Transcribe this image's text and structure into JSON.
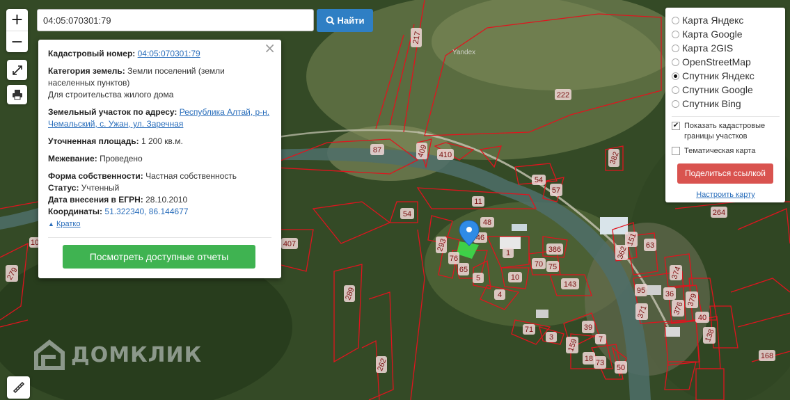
{
  "search": {
    "value": "04:05:070301:79",
    "button_label": "Найти"
  },
  "popup": {
    "cadastral_label": "Кадастровый номер:",
    "cadastral_value": "04:05:070301:79",
    "category_label": "Категория земель:",
    "category_value": "Земли поселений (земли населенных пунктов)",
    "purpose": "Для строительства жилого дома",
    "address_label": "Земельный участок по адресу:",
    "address_value": "Республика Алтай, р-н. Чемальский, с. Ужан, ул. Заречная",
    "area_label": "Уточненная площадь:",
    "area_value": "1 200 кв.м.",
    "survey_label": "Межевание:",
    "survey_value": "Проведено",
    "ownership_label": "Форма собственности:",
    "ownership_value": "Частная собственность",
    "status_label": "Статус:",
    "status_value": "Учтенный",
    "date_label": "Дата внесения в ЕГРН:",
    "date_value": "28.10.2010",
    "coords_label": "Координаты:",
    "coords_value": "51.322340, 86.144677",
    "collapse_label": "Кратко",
    "report_button": "Посмотреть доступные отчеты"
  },
  "layers": {
    "options": [
      "Карта Яндекс",
      "Карта Google",
      "Карта 2GIS",
      "OpenStreetMap",
      "Спутник Яндекс",
      "Спутник Google",
      "Спутник Bing"
    ],
    "selected": "Спутник Яндекс",
    "show_borders_label": "Показать кадастровые границы участков",
    "show_borders_checked": true,
    "thematic_label": "Тематическая карта",
    "thematic_checked": false,
    "share_button": "Поделиться ссылкой",
    "configure_link": "Настроить карту"
  },
  "watermarks": {
    "brand": "ДОМКЛИК",
    "yandex": "Yandex"
  },
  "parcel_labels": [
    "217",
    "222",
    "87",
    "409",
    "410",
    "382",
    "54",
    "57",
    "11",
    "54",
    "48",
    "46",
    "293",
    "1",
    "386",
    "76",
    "65",
    "70",
    "75",
    "5",
    "10",
    "143",
    "4",
    "71",
    "3",
    "159",
    "39",
    "7",
    "18",
    "73",
    "50",
    "151",
    "63",
    "362",
    "374",
    "95",
    "36",
    "379",
    "371",
    "376",
    "40",
    "138",
    "168",
    "262",
    "289",
    "407",
    "279",
    "264",
    "10"
  ],
  "colors": {
    "parcel_border": "#e0141e",
    "marker": "#2f8be6",
    "selected_parcel": "#3ddc4a",
    "share": "#d9534f",
    "report": "#3fb351",
    "find": "#2f7fc4"
  }
}
